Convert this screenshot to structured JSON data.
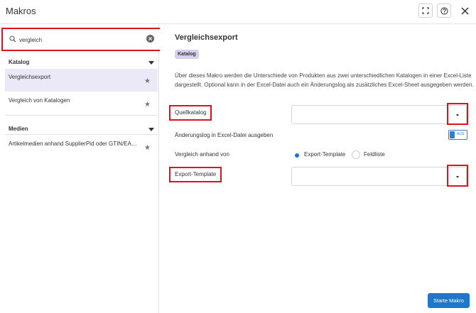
{
  "window": {
    "title": "Makros",
    "fullscreen_icon": "fullscreen-icon",
    "help_icon": "help-icon",
    "close_icon": "close-icon"
  },
  "sidebar": {
    "search": {
      "value": "vergleich",
      "placeholder": ""
    },
    "groups": [
      {
        "label": "Katalog",
        "items": [
          {
            "label": "Vergleichsexport",
            "active": true
          },
          {
            "label": "Vergleich von Katalogen",
            "active": false
          }
        ]
      },
      {
        "label": "Medien",
        "items": [
          {
            "label": "Artikelmedien anhand SupplierPid oder GTIN/EAN ...",
            "active": false
          }
        ]
      }
    ]
  },
  "main": {
    "title": "Vergleichsexport",
    "badge": "Katalog",
    "description": "Über dieses Makro werden die Unterschiede von Produkten aus zwei unterschiedlichen Katalogen in einer Excel-Liste dargestellt. Optional kann in der Excel-Datei auch ein Änderungslog als zusätzliches Excel-Sheet ausgegeben werden.",
    "fields": {
      "source_catalog_label": "Quellkatalog",
      "source_catalog_value": "",
      "change_log_label": "Änderungslog in Excel-Datei ausgeben",
      "change_log_toggle": "AUS",
      "compare_by_label": "Vergleich anhand von",
      "compare_options": [
        "Export-Template",
        "Feldliste"
      ],
      "compare_selected": "Export-Template",
      "export_template_label": "Export-Template",
      "export_template_value": ""
    },
    "start_button": "Starte Makro"
  },
  "colors": {
    "accent": "#1f77c9",
    "highlight": "#d9141e",
    "active_item_bg": "#ebe8f7",
    "badge_bg": "#d6d0ee"
  }
}
